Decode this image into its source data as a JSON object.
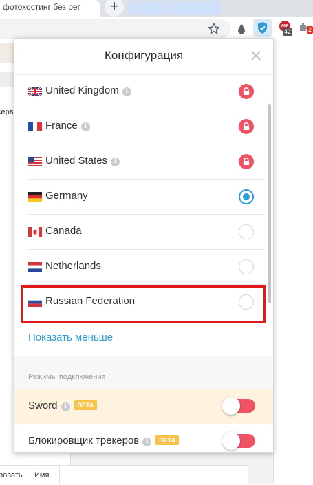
{
  "browser": {
    "active_tab_title": "фотохостинг без рег",
    "new_tab_symbol": "+",
    "extensions": {
      "adblock_label": "ABP",
      "adblock_count": "42",
      "other_badge": "2"
    }
  },
  "background_page": {
    "left_snippet": "серв",
    "bottom_left_text": "ровать",
    "bottom_name_text": "Имя"
  },
  "popup": {
    "title": "Конфигурация",
    "countries": [
      {
        "name": "United Kingdom",
        "flag": "uk-flag",
        "info": true,
        "state": "locked"
      },
      {
        "name": "France",
        "flag": "france-flag",
        "info": true,
        "state": "locked"
      },
      {
        "name": "United States",
        "flag": "us-flag",
        "info": true,
        "state": "locked"
      },
      {
        "name": "Germany",
        "flag": "germany-flag",
        "info": false,
        "state": "selected"
      },
      {
        "name": "Canada",
        "flag": "canada-flag",
        "info": false,
        "state": "unselected"
      },
      {
        "name": "Netherlands",
        "flag": "netherlands-flag",
        "info": false,
        "state": "unselected"
      },
      {
        "name": "Russian Federation",
        "flag": "russia-flag",
        "info": false,
        "state": "unselected"
      }
    ],
    "show_less": "Показать меньше",
    "modes_heading": "Режимы подключения",
    "modes": [
      {
        "name": "Sword",
        "badge": "BETA",
        "enabled": true
      },
      {
        "name": "Блокировщик трекеров",
        "badge": "BETA",
        "enabled": true
      }
    ]
  },
  "colors": {
    "accent_blue": "#2d9cdb",
    "lock_red": "#f05264",
    "beta_yellow": "#f8c34a",
    "sword_row_bg": "#fdf3df",
    "highlight_red": "#e01b1b"
  }
}
